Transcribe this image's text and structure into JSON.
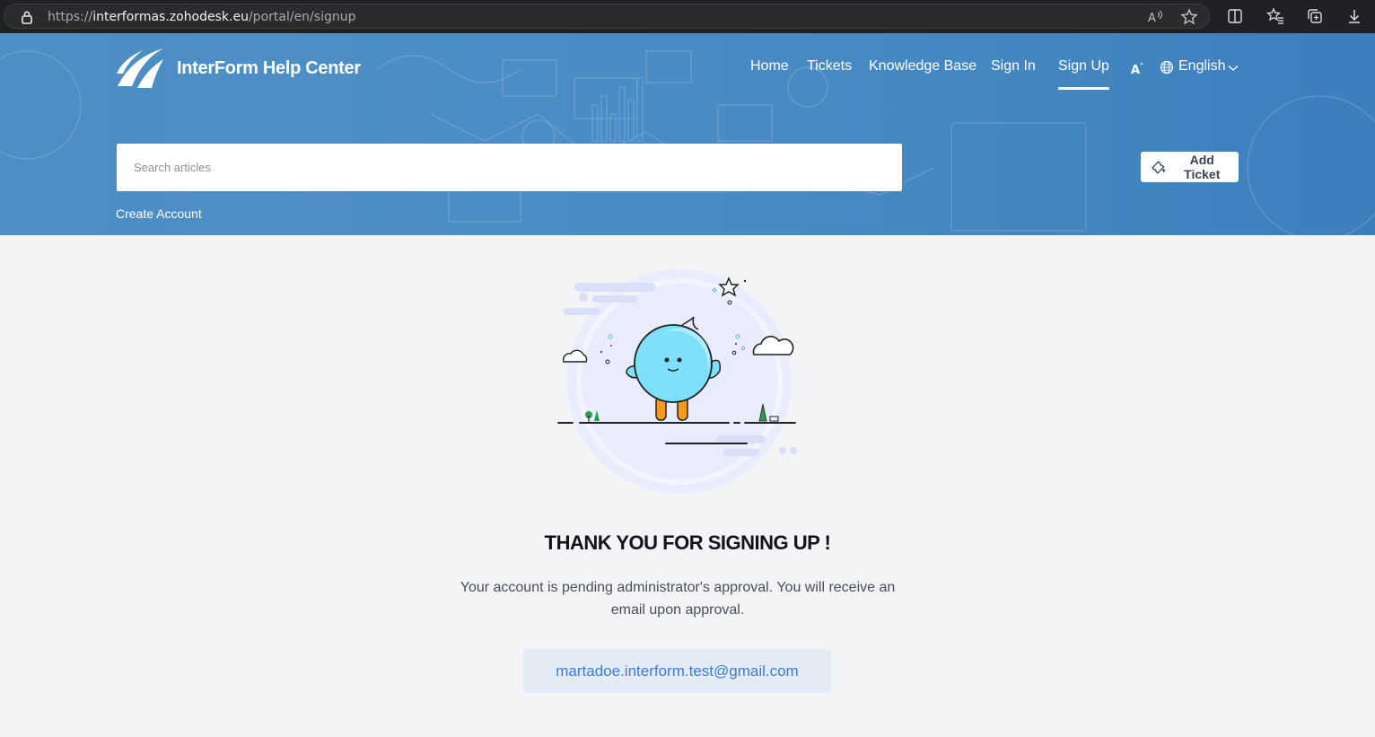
{
  "browser": {
    "url_prefix": "https://",
    "url_host": "interformas.zohodesk.eu",
    "url_path": "/portal/en/signup"
  },
  "header": {
    "brand": "InterForm Help Center",
    "nav": [
      "Home",
      "Tickets",
      "Knowledge Base",
      "Sign In",
      "Sign Up"
    ],
    "active_nav": "Sign Up",
    "language": "English",
    "search_placeholder": "Search articles",
    "add_ticket": "Add Ticket",
    "create_account": "Create Account"
  },
  "main": {
    "title": "THANK YOU FOR SIGNING UP !",
    "message": "Your account is pending administrator's approval. You will receive an email upon approval.",
    "email": "martadoe.interform.test@gmail.com"
  },
  "colors": {
    "header_blue": "#4a8bc5",
    "email_link": "#3f7ad6",
    "email_bg": "#e4ebf7",
    "page_bg": "#f3f4f6"
  }
}
